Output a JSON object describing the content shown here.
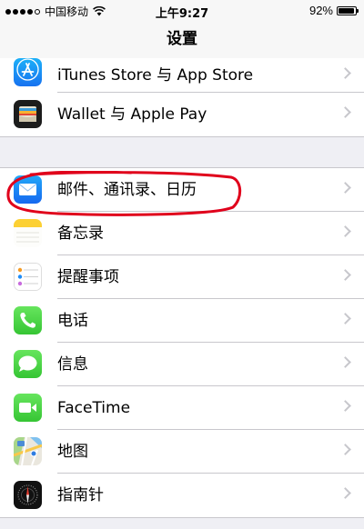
{
  "status": {
    "carrier": "中国移动",
    "time": "上午9:27",
    "battery": "92%",
    "battery_level": 0.92
  },
  "nav": {
    "title": "设置"
  },
  "group1": [
    {
      "label": "iTunes Store 与 App Store",
      "icon": "app-store-icon",
      "color": "#1e8cf7"
    },
    {
      "label": "Wallet 与 Apple Pay",
      "icon": "wallet-icon",
      "color": "#000000"
    }
  ],
  "group2": [
    {
      "label": "邮件、通讯录、日历",
      "icon": "mail-icon",
      "color": "#1e7ff5"
    },
    {
      "label": "备忘录",
      "icon": "notes-icon",
      "color": "#fecd2f"
    },
    {
      "label": "提醒事项",
      "icon": "reminders-icon",
      "color": "#ffffff"
    },
    {
      "label": "电话",
      "icon": "phone-icon",
      "color": "#4cd964"
    },
    {
      "label": "信息",
      "icon": "messages-icon",
      "color": "#4cd964"
    },
    {
      "label": "FaceTime",
      "icon": "facetime-icon",
      "color": "#4cd964"
    },
    {
      "label": "地图",
      "icon": "maps-icon",
      "color": "#e9eee0"
    },
    {
      "label": "指南针",
      "icon": "compass-icon",
      "color": "#000000"
    }
  ],
  "annotation_color": "#e0001b"
}
